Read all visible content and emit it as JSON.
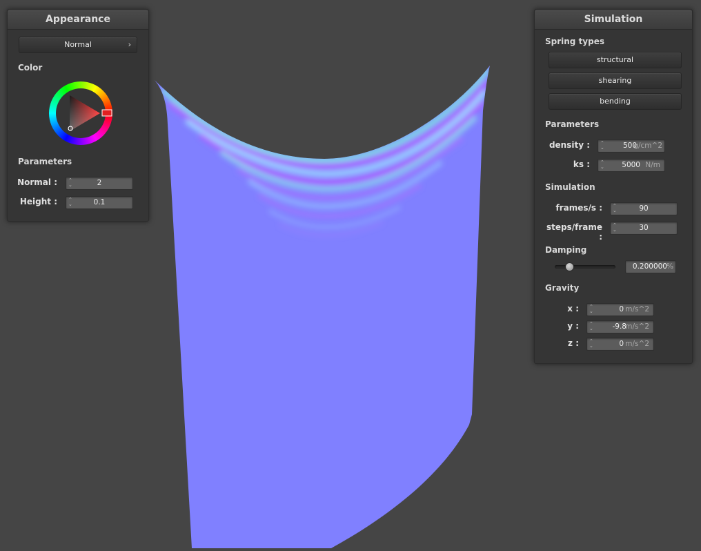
{
  "appearance": {
    "title": "Appearance",
    "shader_label": "Normal",
    "color_label": "Color",
    "params_label": "Parameters",
    "normal_label": "Normal :",
    "normal_value": "2",
    "height_label": "Height :",
    "height_value": "0.1"
  },
  "simulation": {
    "title": "Simulation",
    "spring_types_label": "Spring types",
    "spring_buttons": [
      "structural",
      "shearing",
      "bending"
    ],
    "params_label": "Parameters",
    "density_label": "density :",
    "density_value": "500",
    "density_unit": "g/cm^2",
    "ks_label": "ks :",
    "ks_value": "5000",
    "ks_unit": "N/m",
    "sim_label": "Simulation",
    "fps_label": "frames/s :",
    "fps_value": "90",
    "steps_label": "steps/frame :",
    "steps_value": "30",
    "damping_label": "Damping",
    "damping_value": "0.200000",
    "damping_unit": "%",
    "damping_level": 0.2,
    "gravity_label": "Gravity",
    "gx_label": "x :",
    "gx_value": "0",
    "gy_label": "y :",
    "gy_value": "-9.8",
    "gz_label": "z :",
    "gz_value": "0",
    "gravity_unit": "m/s^2"
  },
  "colors": {
    "background": "#454545",
    "cloth": "#8080ff",
    "panel": "#353535"
  },
  "icons": {
    "chevron": "chevron-right-icon",
    "spinner": "spinner-arrows-icon"
  }
}
